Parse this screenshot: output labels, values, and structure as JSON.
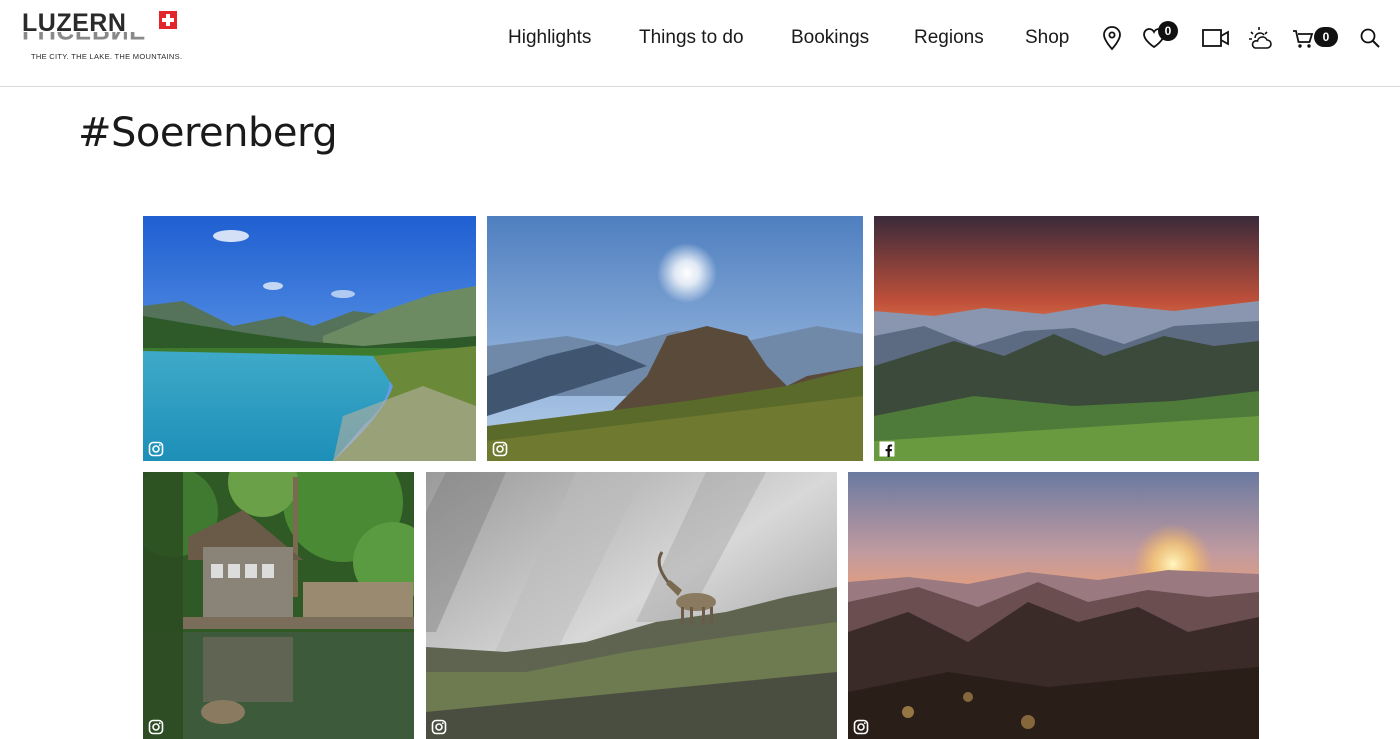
{
  "logo": {
    "word": "LUZERN",
    "mirror_word": "LUCERNE",
    "tagline": "THE CITY. THE LAKE. THE MOUNTAINS."
  },
  "nav": {
    "items": [
      {
        "label": "Highlights"
      },
      {
        "label": "Things to do"
      },
      {
        "label": "Bookings"
      },
      {
        "label": "Regions"
      },
      {
        "label": "Shop"
      }
    ]
  },
  "toolbar": {
    "icons": [
      "map-pin-icon",
      "heart-icon",
      "video-icon",
      "weather-icon",
      "cart-icon",
      "search-icon"
    ],
    "wishlist_count": "0",
    "cart_count": "0"
  },
  "page": {
    "title": "#Soerenberg"
  },
  "gallery": {
    "items": [
      {
        "subject": "alpine lake",
        "source": "instagram"
      },
      {
        "subject": "sun over rock peak",
        "source": "instagram"
      },
      {
        "subject": "sunset over mountains",
        "source": "facebook"
      },
      {
        "subject": "wooden cabin by pond",
        "source": "instagram"
      },
      {
        "subject": "ibex on ridge",
        "source": "instagram"
      },
      {
        "subject": "sunset over valley",
        "source": "instagram"
      }
    ]
  },
  "colors": {
    "brand_red": "#e3262b",
    "text": "#1a1a1a",
    "badge": "#111111"
  }
}
